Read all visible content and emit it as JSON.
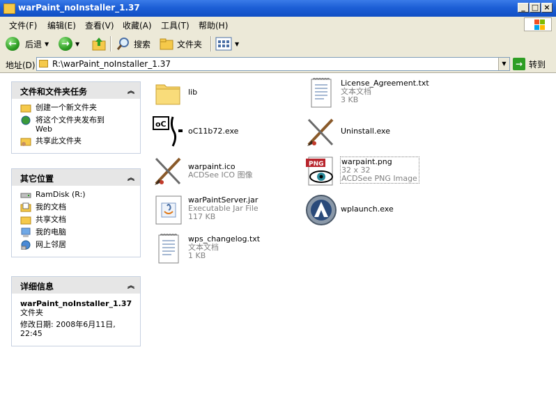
{
  "window": {
    "title": "warPaint_noInstaller_1.37"
  },
  "menu": [
    "文件(F)",
    "编辑(E)",
    "查看(V)",
    "收藏(A)",
    "工具(T)",
    "帮助(H)"
  ],
  "toolbar": {
    "back": "后退",
    "search": "搜索",
    "folders": "文件夹"
  },
  "address": {
    "label": "地址(D)",
    "value": "R:\\warPaint_noInstaller_1.37",
    "go": "转到"
  },
  "tasks": {
    "title": "文件和文件夹任务",
    "items": [
      "创建一个新文件夹",
      "将这个文件夹发布到\nWeb",
      "共享此文件夹"
    ]
  },
  "places": {
    "title": "其它位置",
    "items": [
      "RamDisk (R:)",
      "我的文档",
      "共享文档",
      "我的电脑",
      "网上邻居"
    ]
  },
  "details": {
    "title": "详细信息",
    "name": "warPaint_noInstaller_1.37",
    "type": "文件夹",
    "modified": "修改日期: 2008年6月11日,\n22:45"
  },
  "files": [
    {
      "name": "lib",
      "line2": "",
      "line3": "",
      "icon": "folder-icon"
    },
    {
      "name": "License_Agreement.txt",
      "line2": "文本文档",
      "line3": "3 KB",
      "icon": "text-document-icon"
    },
    {
      "name": "oC11b72.exe",
      "line2": "",
      "line3": "",
      "icon": "oc-exe-icon"
    },
    {
      "name": "Uninstall.exe",
      "line2": "",
      "line3": "",
      "icon": "paintbrush-icon"
    },
    {
      "name": "warpaint.ico",
      "line2": "ACDSee ICO 图像",
      "line3": "",
      "icon": "paintbrush-icon"
    },
    {
      "name": "warpaint.png",
      "line2": "32 x 32",
      "line3": "ACDSee PNG Image",
      "icon": "png-image-icon"
    },
    {
      "name": "warPaintServer.jar",
      "line2": "Executable Jar File",
      "line3": "117 KB",
      "icon": "jar-file-icon"
    },
    {
      "name": "wplaunch.exe",
      "line2": "",
      "line3": "",
      "icon": "launcher-icon"
    },
    {
      "name": "wps_changelog.txt",
      "line2": "文本文档",
      "line3": "1 KB",
      "icon": "text-document-icon"
    }
  ]
}
